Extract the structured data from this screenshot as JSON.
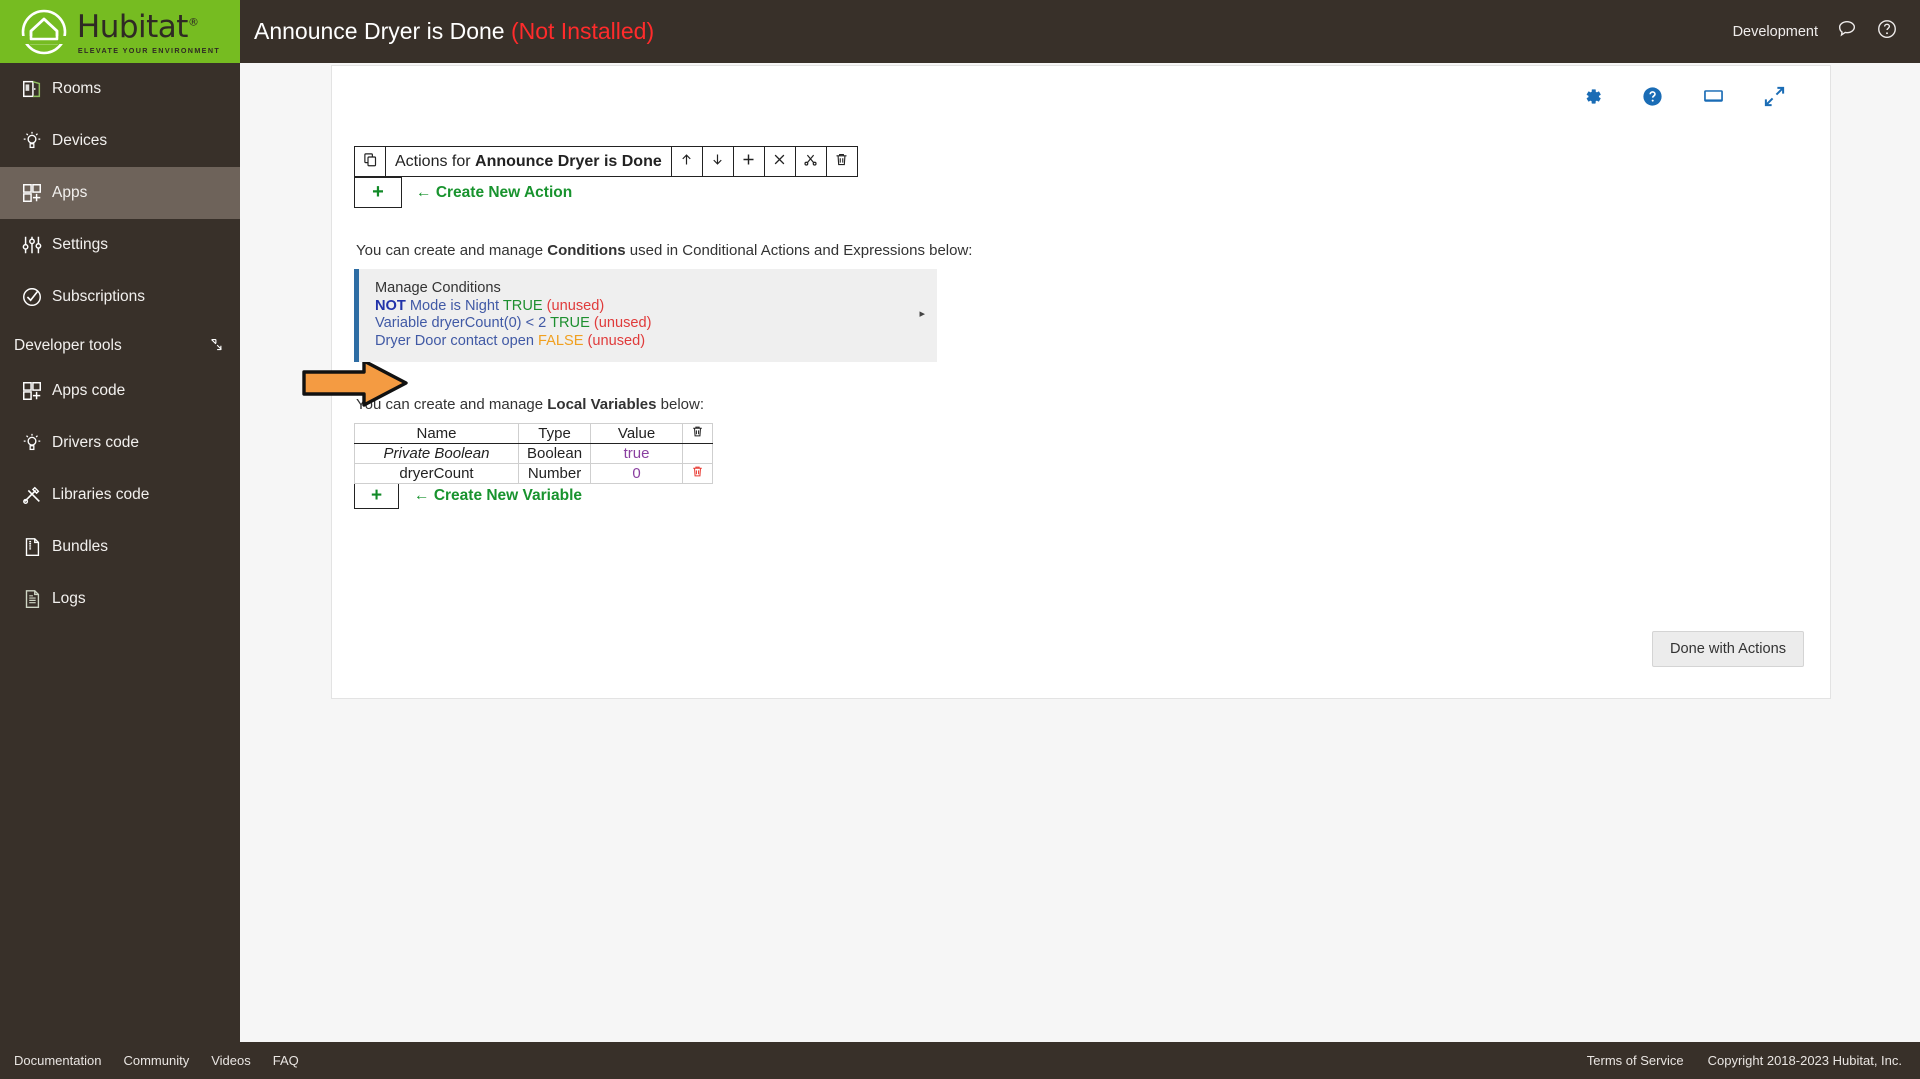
{
  "brand": {
    "name": "Hubitat",
    "trademark": "®",
    "tagline": "ELEVATE YOUR ENVIRONMENT",
    "green": "#76bc21",
    "dark": "#383029"
  },
  "sidebar": {
    "items": [
      {
        "label": "Rooms",
        "icon": "door-icon",
        "active": false
      },
      {
        "label": "Devices",
        "icon": "bulb-icon",
        "active": false
      },
      {
        "label": "Apps",
        "icon": "apps-grid-icon",
        "active": true
      },
      {
        "label": "Settings",
        "icon": "sliders-icon",
        "active": false
      },
      {
        "label": "Subscriptions",
        "icon": "check-circle-icon",
        "active": false
      }
    ],
    "section": {
      "label": "Developer tools",
      "collapse_icon": "collapse-icon"
    },
    "dev_items": [
      {
        "label": "Apps code",
        "icon": "apps-grid-icon"
      },
      {
        "label": "Drivers code",
        "icon": "bulb-icon"
      },
      {
        "label": "Libraries code",
        "icon": "tools-icon"
      },
      {
        "label": "Bundles",
        "icon": "zip-file-icon"
      },
      {
        "label": "Logs",
        "icon": "document-icon"
      }
    ]
  },
  "topbar": {
    "title": "Announce Dryer is Done",
    "status": "(Not Installed)",
    "status_color": "#ff2b2b",
    "environment": "Development",
    "icons": [
      "chat-bubble-icon",
      "help-circle-icon"
    ]
  },
  "card": {
    "icons": [
      "gear-icon",
      "help-circle-icon",
      "display-icon",
      "expand-icon"
    ],
    "icon_color": "#1a6cb5"
  },
  "actions": {
    "copy_icon": "copy-icon",
    "title_prefix": "Actions for ",
    "title_name": "Announce Dryer is Done",
    "toolbar_icons": [
      {
        "name": "move-up-icon",
        "glyph": "↑"
      },
      {
        "name": "move-down-icon",
        "glyph": "↓"
      },
      {
        "name": "add-icon",
        "glyph": "＋"
      },
      {
        "name": "close-icon",
        "glyph": "✕"
      },
      {
        "name": "scissors-icon",
        "glyph": "✂"
      },
      {
        "name": "trash-icon",
        "glyph": "Ὕ1"
      }
    ],
    "create_plus": "+",
    "create_arrow": "←",
    "create_label": "Create New Action",
    "link_color": "#18932e"
  },
  "conditions": {
    "intro_a": "You can create and manage ",
    "intro_b": "Conditions",
    "intro_c": " used in Conditional Actions and Expressions below:",
    "panel_title": "Manage Conditions",
    "accent": "#2e6da4",
    "caret": "▸",
    "rows": [
      {
        "parts": [
          {
            "text": "NOT",
            "style": "bluebold"
          },
          {
            "text": " Mode is Night ",
            "style": "blue"
          },
          {
            "text": "TRUE",
            "style": "green"
          },
          {
            "text": " (unused)",
            "style": "red"
          }
        ]
      },
      {
        "parts": [
          {
            "text": "Variable dryerCount(0) < 2 ",
            "style": "blue"
          },
          {
            "text": "TRUE",
            "style": "green"
          },
          {
            "text": " (unused)",
            "style": "red"
          }
        ]
      },
      {
        "parts": [
          {
            "text": "Dryer Door contact open ",
            "style": "blue"
          },
          {
            "text": "FALSE",
            "style": "orange"
          },
          {
            "text": " (unused)",
            "style": "red"
          }
        ]
      }
    ]
  },
  "variables": {
    "intro_a": "You can create and manage ",
    "intro_b": "Local Variables",
    "intro_c": " below:",
    "columns": [
      "Name",
      "Type",
      "Value",
      ""
    ],
    "header_delete_icon": "trash-icon",
    "rows": [
      {
        "name": "Private Boolean",
        "italic": true,
        "type": "Boolean",
        "value": "true",
        "delete": false
      },
      {
        "name": "dryerCount",
        "italic": false,
        "type": "Number",
        "value": "0",
        "delete": true
      }
    ],
    "create_plus": "+",
    "create_arrow": "←",
    "create_label": "Create New Variable"
  },
  "done_button": {
    "label": "Done with Actions"
  },
  "footer": {
    "links": [
      "Documentation",
      "Community",
      "Videos",
      "FAQ"
    ],
    "right": [
      "Terms of Service",
      "Copyright 2018-2023 Hubitat, Inc."
    ]
  }
}
